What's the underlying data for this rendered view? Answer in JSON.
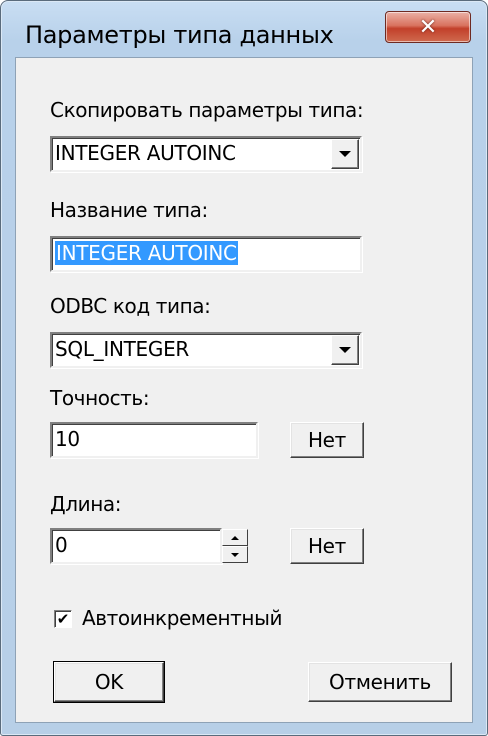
{
  "window": {
    "title": "Параметры типа данных",
    "close_icon": "✕"
  },
  "copy_params": {
    "label": "Скопировать параметры типа:",
    "value": "INTEGER AUTOINC"
  },
  "type_name": {
    "label": "Название типа:",
    "value": "INTEGER AUTOINC"
  },
  "odbc_code": {
    "label": "ODBC код типа:",
    "value": "SQL_INTEGER"
  },
  "precision": {
    "label": "Точность:",
    "value": "10",
    "button": "Нет"
  },
  "length": {
    "label": "Длина:",
    "value": "0",
    "button": "Нет"
  },
  "autoincrement": {
    "label": "Автоинкрементный",
    "checked": true,
    "check_glyph": "✔"
  },
  "buttons": {
    "ok": "OK",
    "cancel": "Отменить"
  },
  "colors": {
    "selection": "#3399ff",
    "dialog_bg": "#f0f0f0",
    "close_button": "#c7442e"
  }
}
